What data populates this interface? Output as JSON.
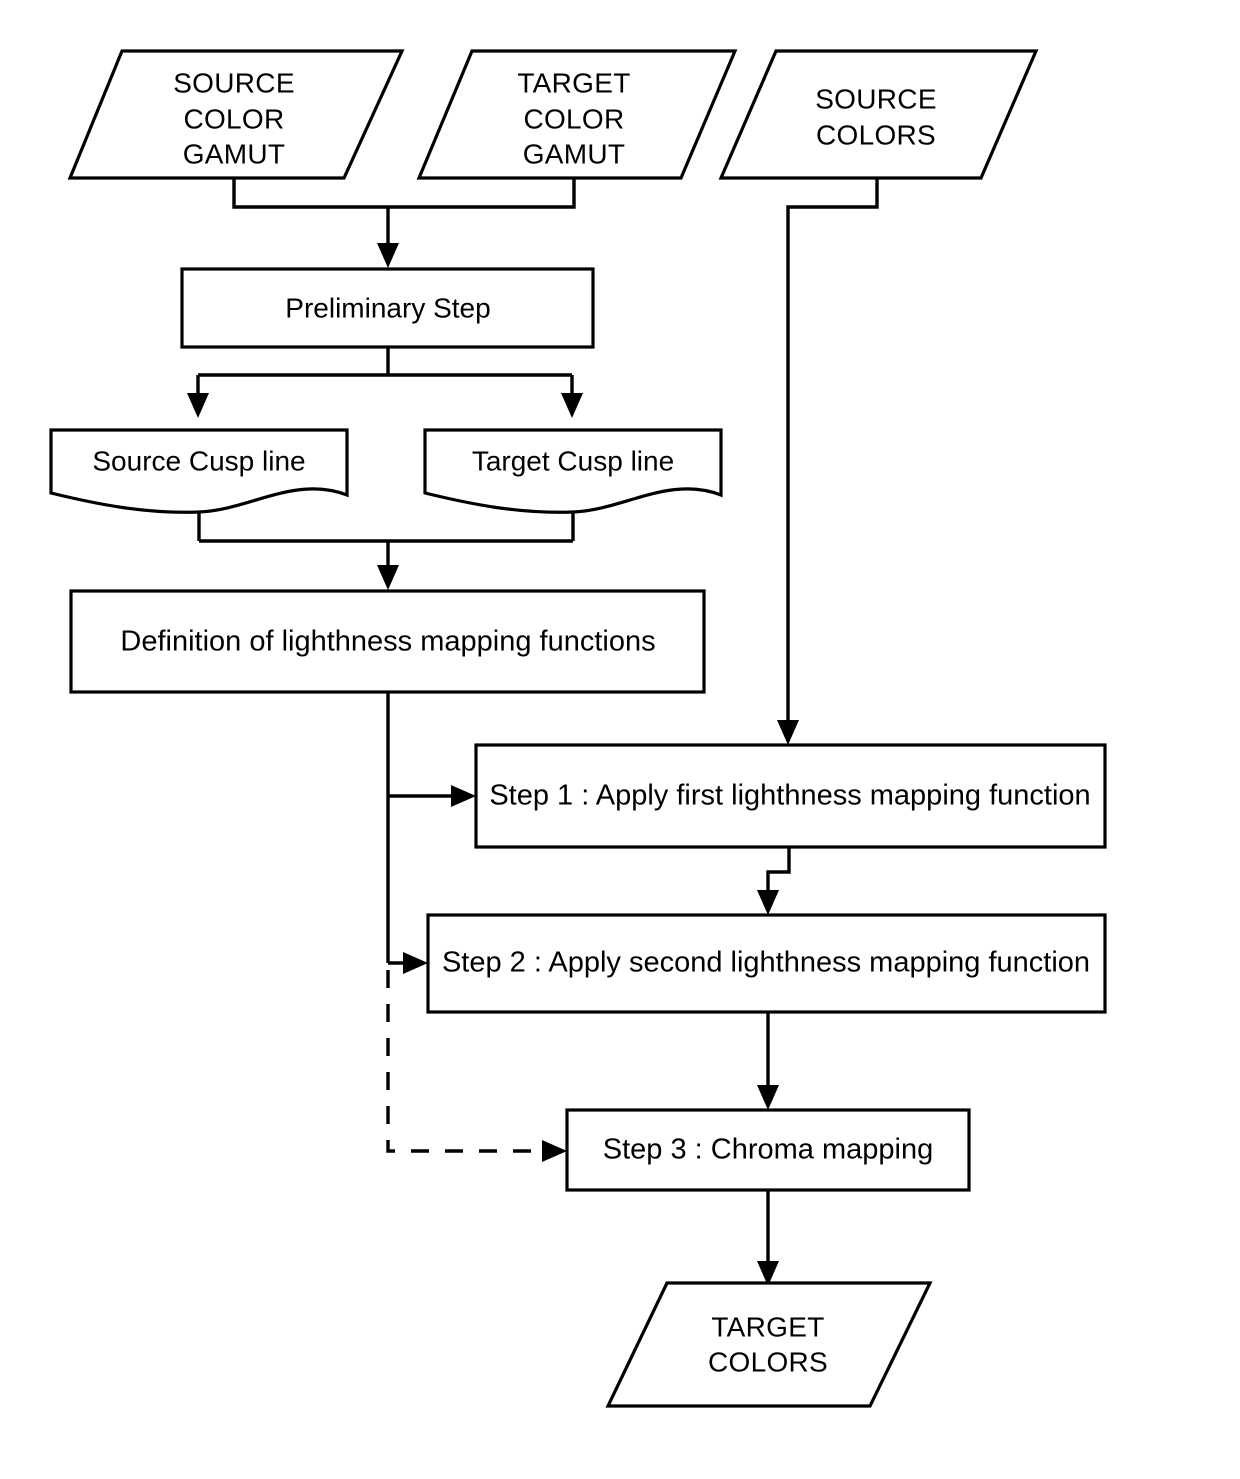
{
  "diagram": {
    "title_present": false,
    "stroke_color": "#000000",
    "fill_color": "#ffffff",
    "nodes": {
      "source_color_gamut": {
        "line1": "SOURCE",
        "line2": "COLOR",
        "line3": "GAMUT"
      },
      "target_color_gamut": {
        "line1": "TARGET",
        "line2": "COLOR",
        "line3": "GAMUT"
      },
      "source_colors": {
        "line1": "SOURCE",
        "line2": "COLORS"
      },
      "preliminary_step": {
        "label": "Preliminary Step"
      },
      "source_cusp_line": {
        "label": "Source Cusp line"
      },
      "target_cusp_line": {
        "label": "Target Cusp line"
      },
      "definition_lightness": {
        "label": "Definition of lighthness mapping functions"
      },
      "step1": {
        "label": "Step 1 : Apply first lighthness mapping function"
      },
      "step2": {
        "label": "Step 2 : Apply second lighthness mapping function"
      },
      "step3": {
        "label": "Step 3 : Chroma mapping"
      },
      "target_colors": {
        "line1": "TARGET",
        "line2": "COLORS"
      }
    },
    "edges": [
      {
        "name": "gamuts-to-preliminary",
        "style": "solid",
        "arrow": true
      },
      {
        "name": "source-colors-to-step1",
        "style": "solid",
        "arrow": true
      },
      {
        "name": "preliminary-to-source-cusp",
        "style": "solid",
        "arrow": true
      },
      {
        "name": "preliminary-to-target-cusp",
        "style": "solid",
        "arrow": true
      },
      {
        "name": "cusps-to-definition",
        "style": "solid",
        "arrow": true
      },
      {
        "name": "definition-to-step1",
        "style": "solid",
        "arrow": true
      },
      {
        "name": "definition-to-step2",
        "style": "solid",
        "arrow": true
      },
      {
        "name": "definition-to-step3",
        "style": "dashed",
        "arrow": true
      },
      {
        "name": "step1-to-step2",
        "style": "solid",
        "arrow": true
      },
      {
        "name": "step2-to-step3",
        "style": "solid",
        "arrow": true
      },
      {
        "name": "step3-to-target-colors",
        "style": "solid",
        "arrow": true
      }
    ]
  }
}
